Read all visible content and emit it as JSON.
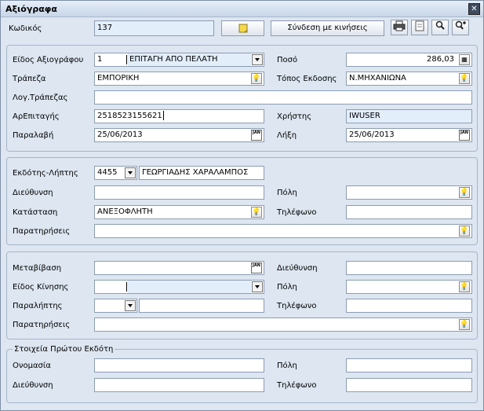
{
  "window": {
    "title": "Αξιόγραφα",
    "close": "✕"
  },
  "top": {
    "kodikos_label": "Κωδικός",
    "kodikos_value": "137",
    "syndesi_label": "Σύνδεση με κινήσεις"
  },
  "doc": {
    "eidos_label": "Είδος Αξιογράφου",
    "eidos_code": "1",
    "eidos_name": "ΕΠΙΤΑΓΗ ΑΠΟ ΠΕΛΑΤΗ",
    "poso_label": "Ποσό",
    "poso_value": "286,03",
    "trapeza_label": "Τράπεζα",
    "trapeza_value": "ΕΜΠΟΡΙΚΗ",
    "topos_label": "Τόπος Εκδοσης",
    "topos_value": "Ν.ΜΗΧΑΝΙΩΝΑ",
    "log_label": "Λογ.Τράπεζας",
    "log_value": "",
    "arepitagis_label": "ΑρΕπιταγής",
    "arepitagis_value": "2518523155621",
    "xristis_label": "Χρήστης",
    "xristis_value": "IWUSER",
    "paralavi_label": "Παραλαβή",
    "paralavi_value": "25/06/2013",
    "lixi_label": "Λήξη",
    "lixi_value": "25/06/2013"
  },
  "issuer": {
    "ekdotis_label": "Εκδότης-Λήπτης",
    "ekdotis_code": "4455",
    "ekdotis_name": "ΓΕΩΡΓΙΑΔΗΣ ΧΑΡΑΛΑΜΠΟΣ",
    "dieythynsi_label": "Διεύθυνση",
    "dieythynsi_value": "",
    "poli_label": "Πόλη",
    "poli_value": "",
    "katastasi_label": "Κατάσταση",
    "katastasi_value": "ΑΝΕΞΟΦΛΗΤΗ",
    "tilefono_label": "Τηλέφωνο",
    "tilefono_value": "",
    "paratiriseis_label": "Παρατηρήσεις",
    "paratiriseis_value": ""
  },
  "transfer": {
    "metavivasi_label": "Μεταβίβαση",
    "metavivasi_value": "",
    "dieythynsi_label": "Διεύθυνση",
    "dieythynsi_value": "",
    "eidos_label": "Είδος Κίνησης",
    "eidos_value": "",
    "poli_label": "Πόλη",
    "poli_value": "",
    "paraliptis_label": "Παραλήπτης",
    "paraliptis_value": "",
    "tilefono_label": "Τηλέφωνο",
    "tilefono_value": "",
    "paratiriseis_label": "Παρατηρήσεις",
    "paratiriseis_value": ""
  },
  "first_issuer": {
    "group_label": "Στοιχεία Πρώτου Εκδότη",
    "onomasia_label": "Ονομασία",
    "onomasia_value": "",
    "poli_label": "Πόλη",
    "poli_value": "",
    "dieythynsi_label": "Διεύθυνση",
    "dieythynsi_value": "",
    "tilefono_label": "Τηλέφωνο",
    "tilefono_value": ""
  },
  "icons": {
    "lookup": "lightbulb-icon",
    "calendar": "calendar-icon",
    "calculator": "calculator-icon",
    "printer": "printer-icon",
    "document": "document-icon",
    "search": "search-icon",
    "zoom_add": "zoom-add-icon",
    "note": "note-icon"
  },
  "calendar_glyph": "JAN"
}
